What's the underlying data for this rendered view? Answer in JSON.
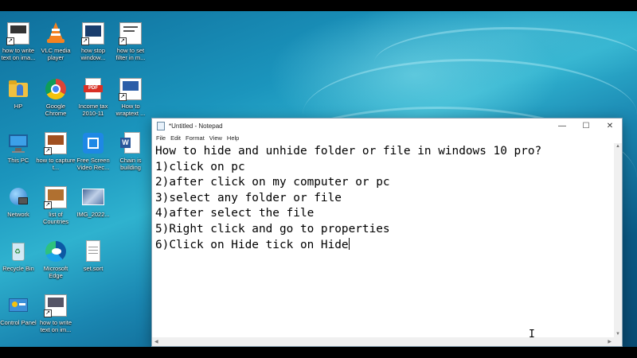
{
  "desktop": {
    "icons": [
      {
        "label": "how to write text on ima...",
        "icon": "text-image-icon"
      },
      {
        "label": "VLC media player",
        "icon": "vlc-cone-icon"
      },
      {
        "label": "how stop window...",
        "icon": "window-shortcut-icon"
      },
      {
        "label": "how to set filter in m...",
        "icon": "filter-shortcut-icon"
      },
      {
        "label": "HP",
        "icon": "hp-folder-icon"
      },
      {
        "label": "Google Chrome",
        "icon": "chrome-icon"
      },
      {
        "label": "Income tax 2010-11",
        "icon": "pdf-icon"
      },
      {
        "label": "How to wraptext ...",
        "icon": "wraptext-shortcut-icon"
      },
      {
        "label": "This PC",
        "icon": "this-pc-icon"
      },
      {
        "label": "how to capture t...",
        "icon": "capture-shortcut-icon"
      },
      {
        "label": "Free Screen Video Rec...",
        "icon": "screen-recorder-icon"
      },
      {
        "label": "Chain is building",
        "icon": "word-doc-icon"
      },
      {
        "label": "Network",
        "icon": "network-icon"
      },
      {
        "label": "list of Countries",
        "icon": "countries-shortcut-icon"
      },
      {
        "label": "IMG_2022...",
        "icon": "image-thumbnail-icon"
      },
      {
        "label": "Recycle Bin",
        "icon": "recycle-bin-icon"
      },
      {
        "label": "Microsoft Edge",
        "icon": "edge-icon"
      },
      {
        "label": "set.sort",
        "icon": "text-file-icon"
      },
      {
        "label": "Control Panel",
        "icon": "control-panel-icon"
      },
      {
        "label": "how to write text on im...",
        "icon": "text-image-icon"
      }
    ]
  },
  "notepad": {
    "title": "*Untitled - Notepad",
    "menu": [
      "File",
      "Edit",
      "Format",
      "View",
      "Help"
    ],
    "lines": [
      "How to hide and unhide folder or file in windows 10 pro?",
      "1)click on pc",
      "2)after click on my computer or pc",
      "3)select any folder or file",
      "4)after select the file",
      "5)Right click and go to properties",
      "6)Click on Hide tick on Hide"
    ],
    "controls": {
      "minimize": "—",
      "maximize": "☐",
      "close": "✕"
    }
  },
  "cursor": {
    "glyph": "I"
  }
}
